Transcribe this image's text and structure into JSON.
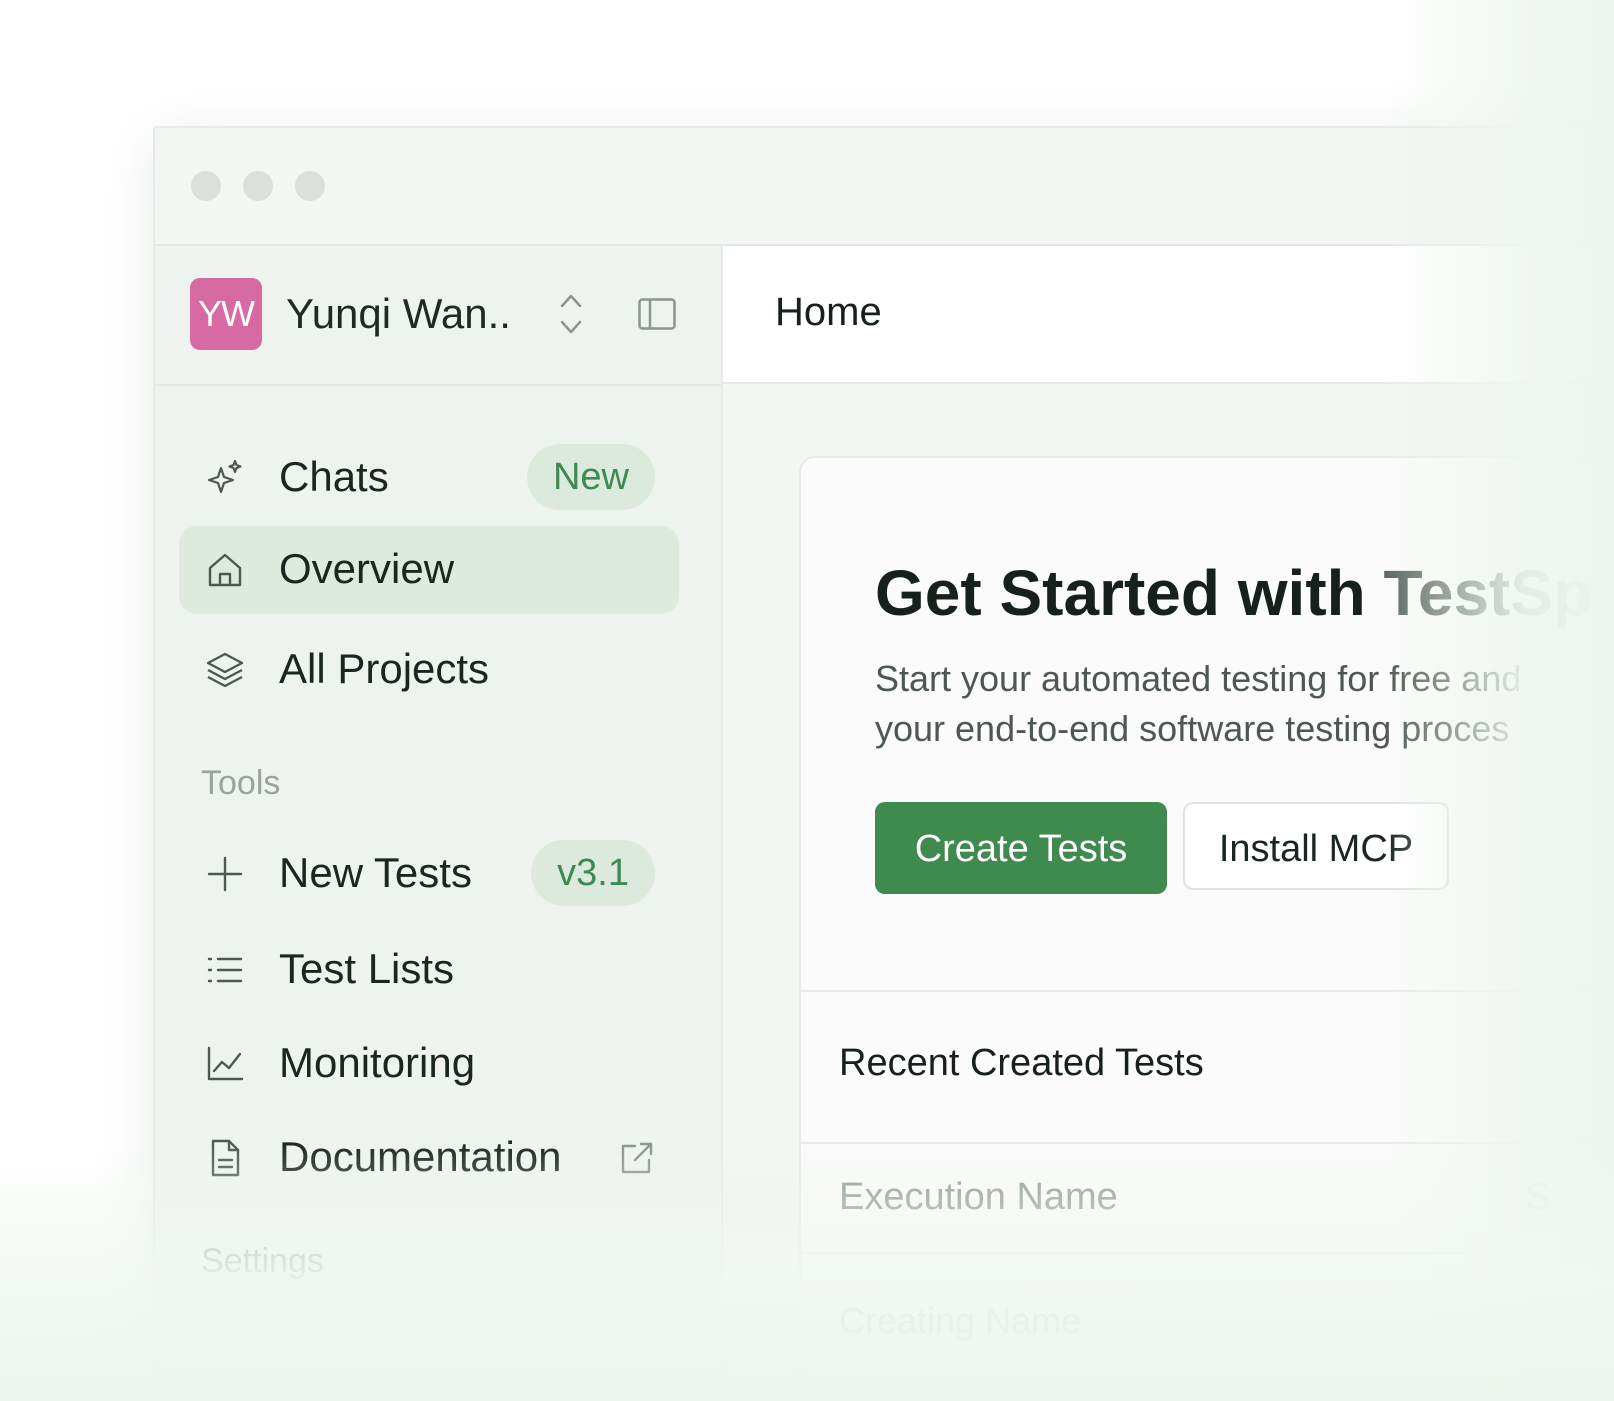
{
  "account": {
    "initials": "YW",
    "name": "Yunqi Wan.."
  },
  "sidebar": {
    "items": [
      {
        "label": "Chats",
        "badge": "New",
        "icon": "sparkles-icon"
      },
      {
        "label": "Overview",
        "icon": "home-icon",
        "active": true
      },
      {
        "label": "All Projects",
        "icon": "layers-icon"
      }
    ],
    "tools_heading": "Tools",
    "tools": [
      {
        "label": "New Tests",
        "badge": "v3.1",
        "icon": "plus-icon"
      },
      {
        "label": "Test Lists",
        "icon": "list-icon"
      },
      {
        "label": "Monitoring",
        "icon": "line-chart-icon"
      },
      {
        "label": "Documentation",
        "icon": "document-icon",
        "external_icon": "external-link-icon"
      }
    ],
    "settings_heading": "Settings"
  },
  "main": {
    "title": "Home",
    "hero": {
      "title_dark": "Get Started with ",
      "title_light": "TestSp",
      "desc_line1": "Start your automated testing for free and",
      "desc_line2": "your end-to-end software testing proces"
    },
    "buttons": {
      "primary": "Create Tests",
      "secondary": "Install MCP"
    },
    "recent": {
      "title": "Recent Created Tests",
      "column_1": "Execution Name",
      "column_2": "S",
      "row_1": "Creating Name"
    }
  },
  "colors": {
    "accent": "#3f8a4e",
    "avatar": "#d76aa2",
    "badge_bg": "#dceadd",
    "active_item_bg": "#dcebdd"
  }
}
